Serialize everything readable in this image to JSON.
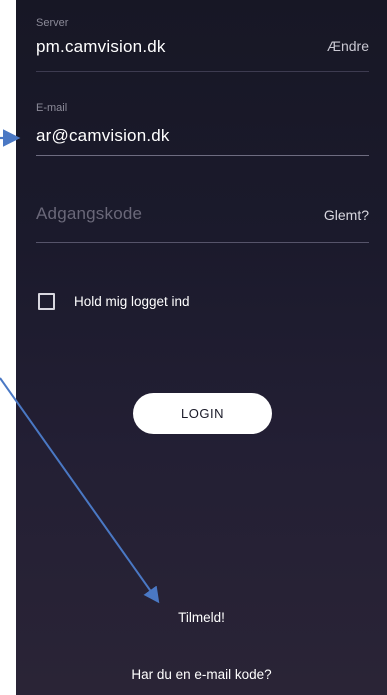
{
  "server": {
    "label": "Server",
    "value": "pm.camvision.dk",
    "action_label": "Ændre"
  },
  "email": {
    "label": "E-mail",
    "value": "ar@camvision.dk"
  },
  "password": {
    "placeholder": "Adgangskode",
    "action_label": "Glemt?"
  },
  "remember": {
    "label": "Hold mig logget ind",
    "checked": false
  },
  "login": {
    "label": "LOGIN"
  },
  "signup": {
    "label": "Tilmeld!"
  },
  "email_code": {
    "label": "Har du en e-mail kode?"
  },
  "colors": {
    "background_top": "#171725",
    "background_bottom": "#2a2436",
    "text": "#ffffff",
    "muted": "#8b8a98",
    "annotation_arrow": "#4a78c4"
  },
  "icons": {
    "annotation_arrows": "arrow-icon"
  }
}
